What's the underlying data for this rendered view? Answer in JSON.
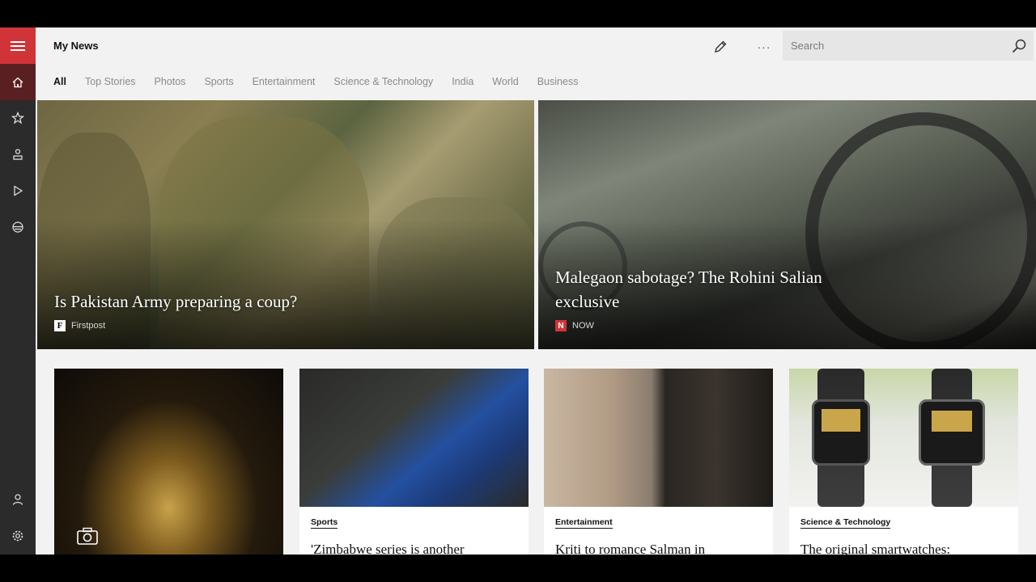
{
  "app": {
    "title": "My News"
  },
  "search": {
    "placeholder": "Search"
  },
  "tabs": [
    {
      "label": "All",
      "active": true
    },
    {
      "label": "Top Stories"
    },
    {
      "label": "Photos"
    },
    {
      "label": "Sports"
    },
    {
      "label": "Entertainment"
    },
    {
      "label": "Science & Technology"
    },
    {
      "label": "India"
    },
    {
      "label": "World"
    },
    {
      "label": "Business"
    }
  ],
  "hero": [
    {
      "title": "Is Pakistan Army preparing a coup?",
      "source": "Firstpost"
    },
    {
      "title_line1": "Malegaon sabotage? The Rohini Salian",
      "title_line2": "exclusive",
      "source": "NOW"
    }
  ],
  "cards": [
    {
      "category": "",
      "title": ""
    },
    {
      "category": "Sports",
      "title": "'Zimbabwe series is another"
    },
    {
      "category": "Entertainment",
      "title": "Kriti to romance Salman in"
    },
    {
      "category": "Science & Technology",
      "title": "The original smartwatches:"
    }
  ],
  "colors": {
    "accent": "#d13438",
    "rail": "#2b2b2b",
    "background": "#f2f2f2"
  },
  "icons": {
    "rail": [
      "hamburger-icon",
      "home-icon",
      "star-icon",
      "local-icon",
      "video-icon",
      "interests-icon",
      "account-icon",
      "settings-icon"
    ],
    "header": [
      "pencil-icon",
      "more-icon",
      "search-icon"
    ]
  }
}
